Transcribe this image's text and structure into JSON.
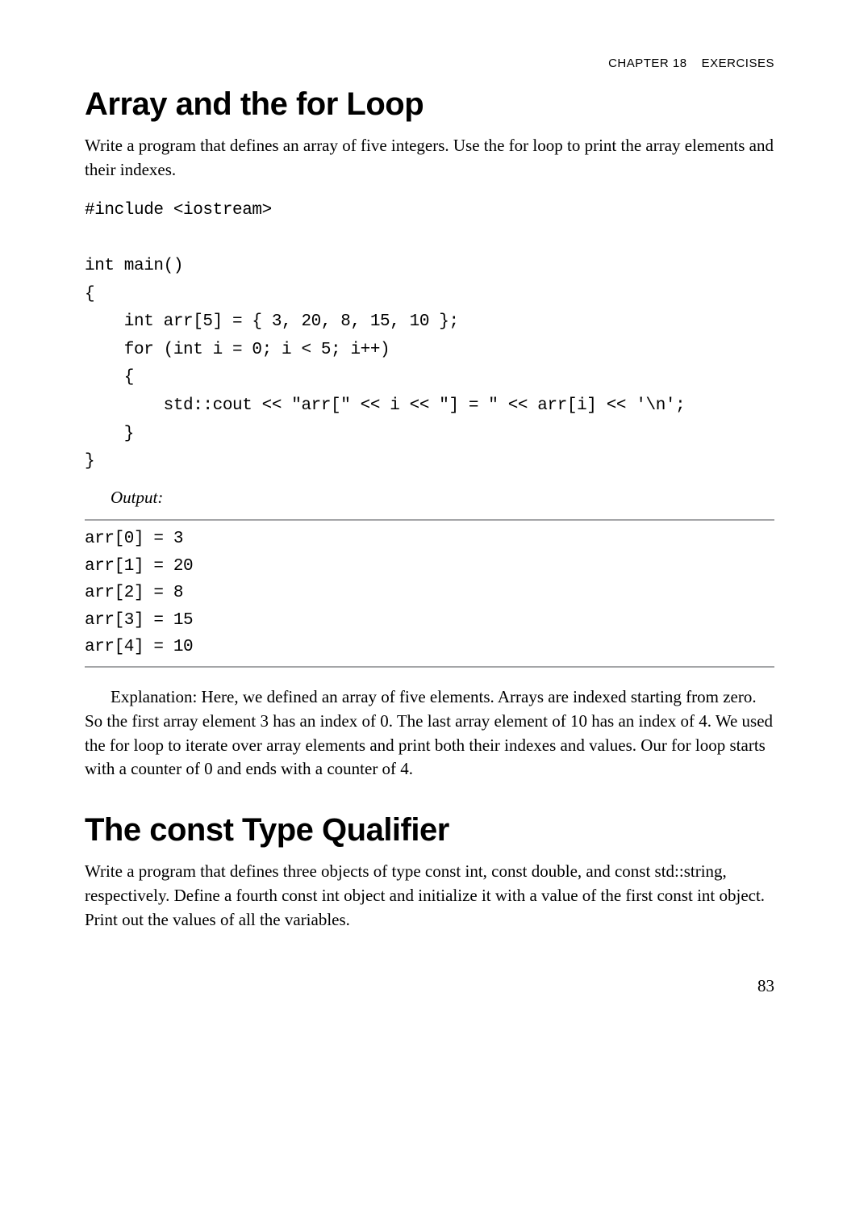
{
  "header": {
    "chapter": "CHAPTER 18",
    "title": "EXERCISES"
  },
  "section1": {
    "heading": "Array and the for Loop",
    "intro": "Write a program that defines an array of five integers. Use the for loop to print the array elements and their indexes.",
    "code": "#include <iostream>\n\nint main()\n{\n    int arr[5] = { 3, 20, 8, 15, 10 };\n    for (int i = 0; i < 5; i++)\n    {\n        std::cout << \"arr[\" << i << \"] = \" << arr[i] << '\\n';\n    }\n}",
    "output_label": "Output:",
    "output": "arr[0] = 3\narr[1] = 20\narr[2] = 8\narr[3] = 15\narr[4] = 10",
    "explanation": "Explanation: Here, we defined an array of five elements. Arrays are indexed starting from zero. So the first array element 3 has an index of 0. The last array element of 10 has an index of 4. We used the for loop to iterate over array elements and print both their indexes and values. Our for loop starts with a counter of 0 and ends with a counter of 4."
  },
  "section2": {
    "heading": "The const Type Qualifier",
    "intro": "Write a program that defines three objects of type const int, const double, and const std::string, respectively. Define a fourth const int object and initialize it with a value of the first const int object. Print out the values of all the variables."
  },
  "page_number": "83"
}
